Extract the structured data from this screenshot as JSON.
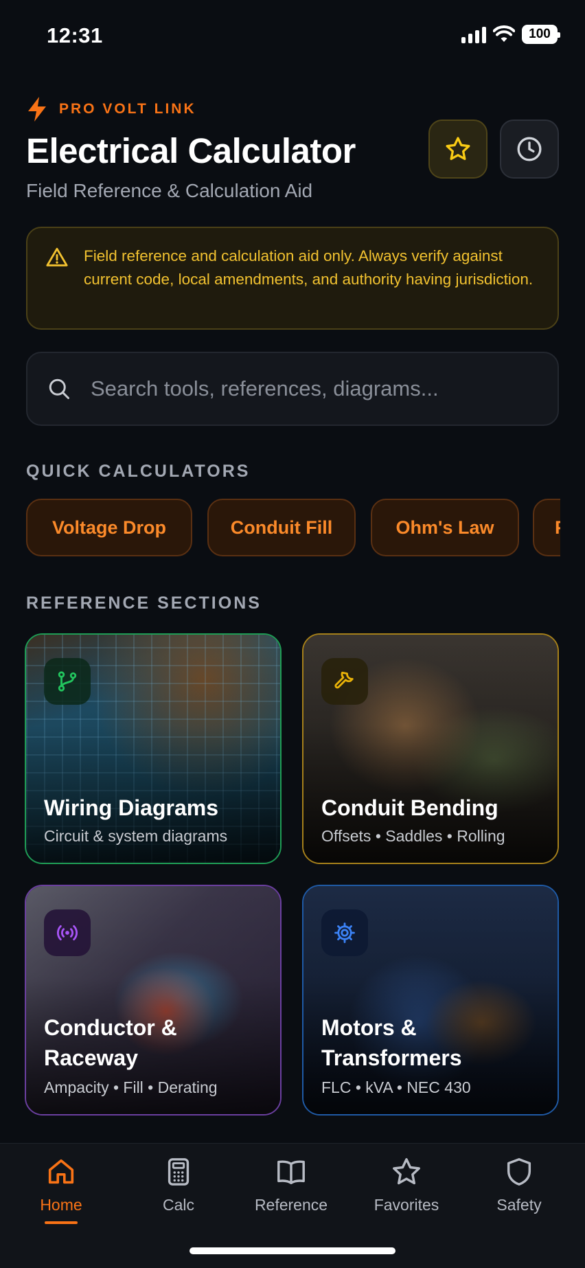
{
  "status_bar": {
    "time": "12:31",
    "battery": "100"
  },
  "header": {
    "brand": "PRO VOLT LINK",
    "title": "Electrical Calculator",
    "subtitle": "Field Reference & Calculation Aid"
  },
  "disclaimer": {
    "text": "Field reference and calculation aid only. Always verify against current code, local amendments, and authority having jurisdiction."
  },
  "search": {
    "placeholder": "Search tools, references, diagrams..."
  },
  "quick_calculators": {
    "title": "QUICK CALCULATORS",
    "items": [
      {
        "label": "Voltage Drop"
      },
      {
        "label": "Conduit Fill"
      },
      {
        "label": "Ohm's Law"
      },
      {
        "label": "P"
      }
    ]
  },
  "reference_sections": {
    "title": "REFERENCE SECTIONS",
    "cards": [
      {
        "title": "Wiring Diagrams",
        "subtitle": "Circuit & system diagrams",
        "icon": "branch-icon",
        "accent": "#22c55e"
      },
      {
        "title": "Conduit Bending",
        "subtitle": "Offsets • Saddles • Rolling",
        "icon": "wrench-icon",
        "accent": "#eab308"
      },
      {
        "title_line1": "Conductor &",
        "title_line2": "Raceway",
        "subtitle": "Ampacity • Fill • Derating",
        "icon": "signal-icon",
        "accent": "#a855f7"
      },
      {
        "title_line1": "Motors &",
        "title_line2": "Transformers",
        "subtitle": "FLC • kVA • NEC 430",
        "icon": "gear-icon",
        "accent": "#3b82f6"
      }
    ]
  },
  "bottom_nav": {
    "items": [
      {
        "label": "Home",
        "icon": "home-icon",
        "active": true
      },
      {
        "label": "Calc",
        "icon": "calculator-icon"
      },
      {
        "label": "Reference",
        "icon": "book-icon"
      },
      {
        "label": "Favorites",
        "icon": "star-icon"
      },
      {
        "label": "Safety",
        "icon": "shield-icon"
      }
    ]
  },
  "colors": {
    "accent": "#f97316",
    "warning": "#f2c230",
    "background": "#0a0d12"
  }
}
